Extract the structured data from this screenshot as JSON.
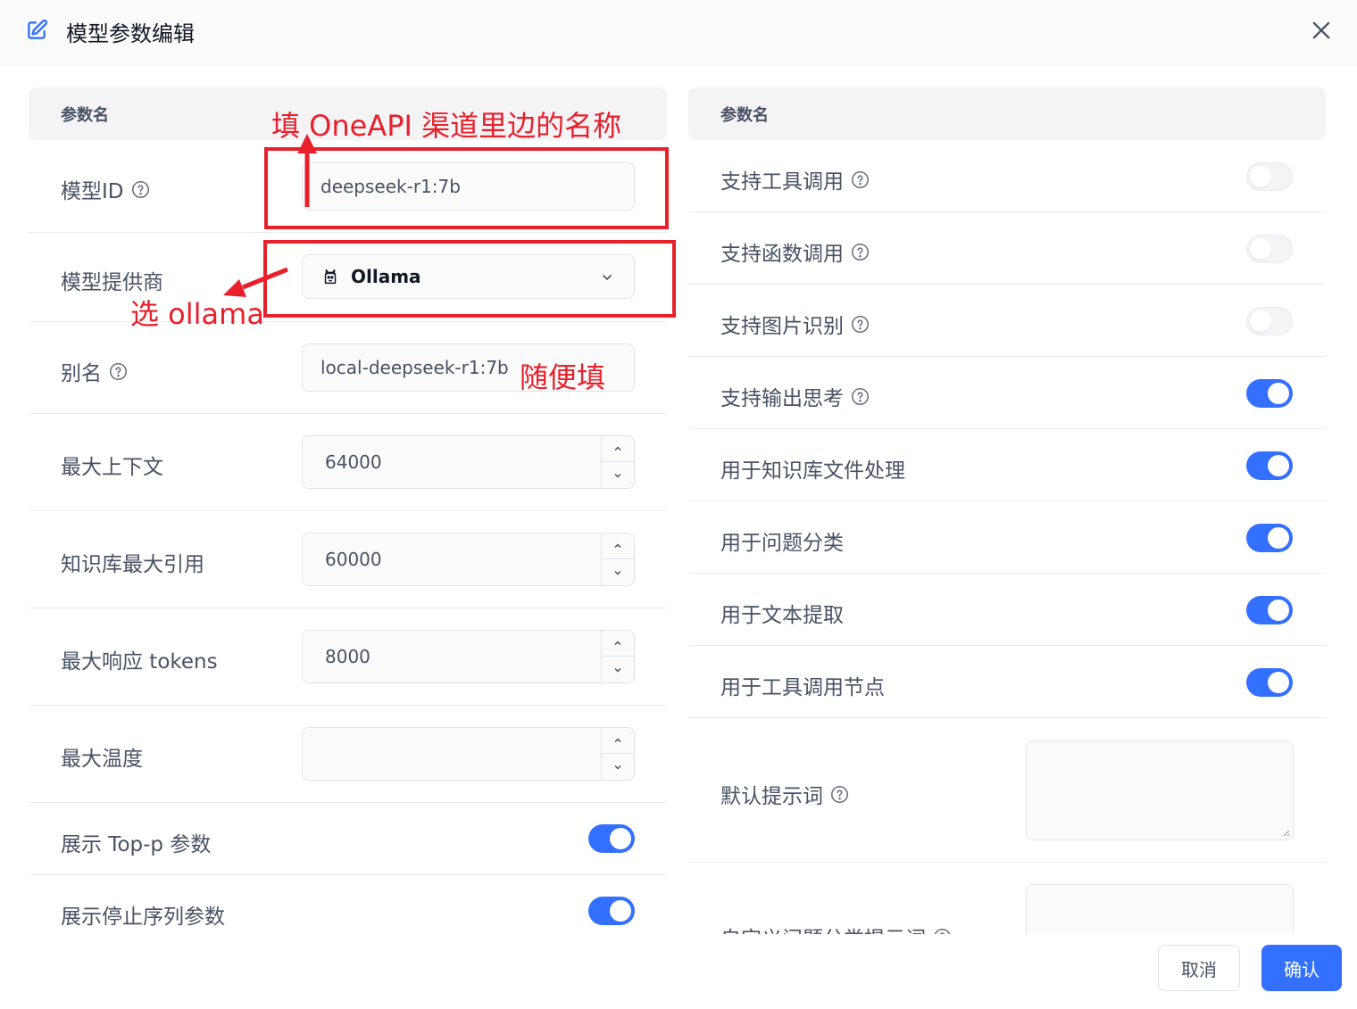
{
  "dialog": {
    "title": "模型参数编辑"
  },
  "left": {
    "header": "参数名",
    "model_id": {
      "label": "模型ID",
      "value": "deepseek-r1:7b"
    },
    "provider": {
      "label": "模型提供商",
      "value": "Ollama"
    },
    "alias": {
      "label": "别名",
      "value": "local-deepseek-r1:7b"
    },
    "max_context": {
      "label": "最大上下文",
      "value": "64000"
    },
    "kb_max_ref": {
      "label": "知识库最大引用",
      "value": "60000"
    },
    "max_tokens": {
      "label": "最大响应 tokens",
      "value": "8000"
    },
    "max_temp": {
      "label": "最大温度",
      "value": ""
    },
    "show_top_p": {
      "label": "展示 Top-p 参数",
      "on": true
    },
    "show_stop": {
      "label": "展示停止序列参数",
      "on": true
    }
  },
  "right": {
    "header": "参数名",
    "toggles": [
      {
        "label": "支持工具调用",
        "help": true,
        "on": false
      },
      {
        "label": "支持函数调用",
        "help": true,
        "on": false
      },
      {
        "label": "支持图片识别",
        "help": true,
        "on": false
      },
      {
        "label": "支持输出思考",
        "help": true,
        "on": true
      },
      {
        "label": "用于知识库文件处理",
        "help": false,
        "on": true
      },
      {
        "label": "用于问题分类",
        "help": false,
        "on": true
      },
      {
        "label": "用于文本提取",
        "help": false,
        "on": true
      },
      {
        "label": "用于工具调用节点",
        "help": false,
        "on": true
      }
    ],
    "default_prompt": {
      "label": "默认提示词"
    },
    "custom_prompt": {
      "label": "自定义问题分类提示词"
    }
  },
  "footer": {
    "cancel": "取消",
    "confirm": "确认"
  },
  "annotations": {
    "oneapi": "填 OneAPI 渠道里边的名称",
    "ollama": "选 ollama",
    "random": "随便填"
  },
  "colors": {
    "accent": "#3370ff",
    "annotation": "#e8202a"
  }
}
